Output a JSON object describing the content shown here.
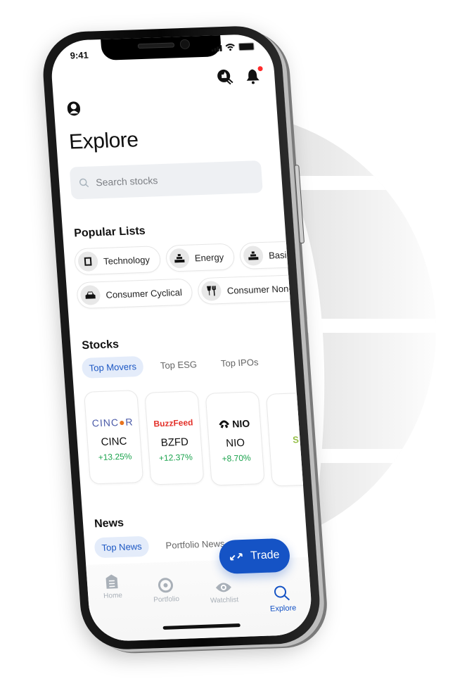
{
  "status_bar": {
    "time": "9:41"
  },
  "header": {
    "title": "Explore",
    "icons": [
      "profile-icon",
      "chat-thumbs-up-icon",
      "bell-icon"
    ],
    "notification_dot_color": "#ff2b2b"
  },
  "search": {
    "placeholder": "Search stocks",
    "value": ""
  },
  "popular_lists": {
    "title": "Popular Lists",
    "row1": [
      {
        "label": "Technology",
        "icon": "chip-icon"
      },
      {
        "label": "Energy",
        "icon": "gold-bars-icon"
      },
      {
        "label": "Basic M",
        "icon": "gold-bars-icon"
      }
    ],
    "row2": [
      {
        "label": "Consumer Cyclical",
        "icon": "car-icon"
      },
      {
        "label": "Consumer Non-Cy",
        "icon": "wine-fork-icon"
      }
    ]
  },
  "stocks": {
    "title": "Stocks",
    "tabs": [
      {
        "label": "Top Movers",
        "active": true
      },
      {
        "label": "Top ESG",
        "active": false
      },
      {
        "label": "Top IPOs",
        "active": false
      }
    ],
    "cards": [
      {
        "logo": "CINCOR",
        "ticker": "CINC",
        "change": "+13.25%"
      },
      {
        "logo": "BuzzFeed",
        "ticker": "BZFD",
        "change": "+12.37%"
      },
      {
        "logo": "NIO",
        "ticker": "NIO",
        "change": "+8.70%"
      },
      {
        "logo": "S",
        "ticker": "",
        "change": ""
      }
    ],
    "positive_color": "#1ba34d"
  },
  "news": {
    "title": "News",
    "tabs": [
      {
        "label": "Top News",
        "active": true
      },
      {
        "label": "Portfolio News",
        "active": false
      }
    ]
  },
  "trade_button": {
    "label": "Trade",
    "color": "#1553c5"
  },
  "bottom_nav": [
    {
      "label": "Home",
      "icon": "home-icon",
      "active": false
    },
    {
      "label": "Portfolio",
      "icon": "portfolio-icon",
      "active": false
    },
    {
      "label": "Watchlist",
      "icon": "eye-icon",
      "active": false
    },
    {
      "label": "Explore",
      "icon": "search-icon",
      "active": true
    }
  ]
}
